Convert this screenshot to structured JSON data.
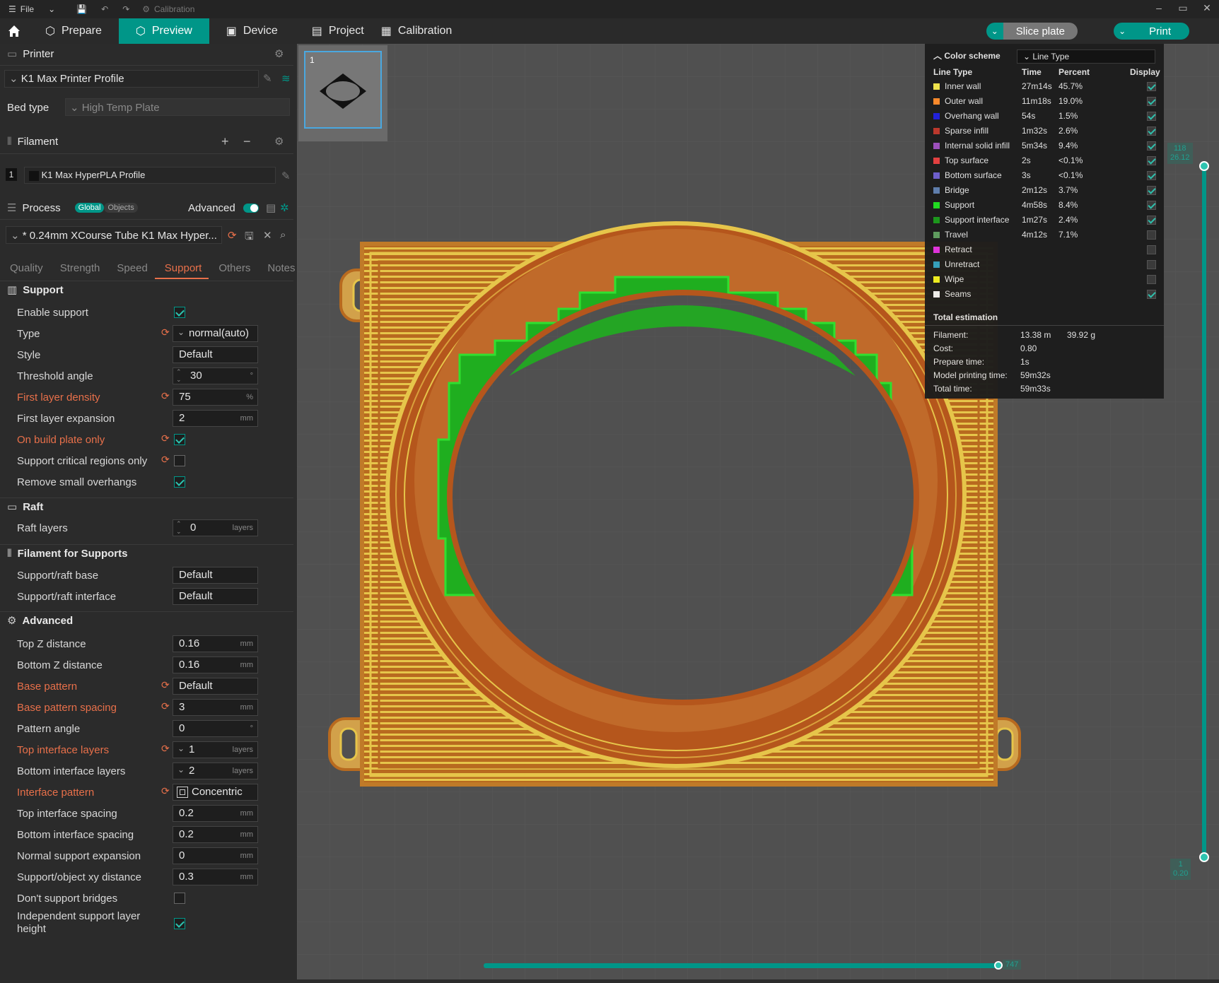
{
  "titlebar": {
    "file_label": "File",
    "calibration_label": "Calibration"
  },
  "nav": {
    "prepare": "Prepare",
    "preview": "Preview",
    "device": "Device",
    "project": "Project",
    "calibration": "Calibration",
    "slice_plate": "Slice plate",
    "print": "Print"
  },
  "printer": {
    "section": "Printer",
    "profile": "K1 Max Printer Profile",
    "bed_type_label": "Bed type",
    "bed_type_value": "High Temp Plate"
  },
  "filament": {
    "section": "Filament",
    "index": "1",
    "profile": "K1 Max HyperPLA Profile"
  },
  "process": {
    "section": "Process",
    "global": "Global",
    "objects": "Objects",
    "advanced": "Advanced",
    "profile": "* 0.24mm XCourse Tube K1 Max Hyper...",
    "tabs": [
      "Quality",
      "Strength",
      "Speed",
      "Support",
      "Others",
      "Notes"
    ]
  },
  "support": {
    "title": "Support",
    "enable_support": "Enable support",
    "type_label": "Type",
    "type_value": "normal(auto)",
    "style_label": "Style",
    "style_value": "Default",
    "threshold_label": "Threshold angle",
    "threshold_value": "30",
    "threshold_unit": "°",
    "first_density_label": "First layer density",
    "first_density_value": "75",
    "first_density_unit": "%",
    "first_expansion_label": "First layer expansion",
    "first_expansion_value": "2",
    "mm": "mm",
    "on_build_plate": "On build plate only",
    "critical_only": "Support critical regions only",
    "remove_small": "Remove small overhangs"
  },
  "raft": {
    "title": "Raft",
    "layers_label": "Raft layers",
    "layers_value": "0",
    "layers_unit": "layers"
  },
  "filament_supports": {
    "title": "Filament for Supports",
    "base_label": "Support/raft base",
    "base_value": "Default",
    "interface_label": "Support/raft interface",
    "interface_value": "Default"
  },
  "advanced": {
    "title": "Advanced",
    "top_z_label": "Top Z distance",
    "top_z_value": "0.16",
    "bottom_z_label": "Bottom Z distance",
    "bottom_z_value": "0.16",
    "base_pattern_label": "Base pattern",
    "base_pattern_value": "Default",
    "base_spacing_label": "Base pattern spacing",
    "base_spacing_value": "3",
    "pattern_angle_label": "Pattern angle",
    "pattern_angle_value": "0",
    "deg": "°",
    "top_interface_layers_label": "Top interface layers",
    "top_interface_layers_value": "1",
    "bottom_interface_layers_label": "Bottom interface layers",
    "bottom_interface_layers_value": "2",
    "interface_pattern_label": "Interface pattern",
    "interface_pattern_value": "Concentric",
    "top_interface_spacing_label": "Top interface spacing",
    "top_interface_spacing_value": "0.2",
    "bottom_interface_spacing_label": "Bottom interface spacing",
    "bottom_interface_spacing_value": "0.2",
    "normal_expansion_label": "Normal support expansion",
    "normal_expansion_value": "0",
    "xy_distance_label": "Support/object xy distance",
    "xy_distance_value": "0.3",
    "dont_bridges_label": "Don't support bridges",
    "independent_label_1": "Independent support layer",
    "independent_label_2": "height",
    "layers_unit": "layers"
  },
  "plate": {
    "number": "1"
  },
  "legend": {
    "title": "Color scheme",
    "mode": "Line Type",
    "col_type": "Line Type",
    "col_time": "Time",
    "col_percent": "Percent",
    "col_display": "Display",
    "rows": [
      {
        "name": "Inner wall",
        "time": "27m14s",
        "percent": "45.7%",
        "color": "#f5e84c",
        "on": true
      },
      {
        "name": "Outer wall",
        "time": "11m18s",
        "percent": "19.0%",
        "color": "#ff8c2a",
        "on": true
      },
      {
        "name": "Overhang wall",
        "time": "54s",
        "percent": "1.5%",
        "color": "#2020e0",
        "on": true
      },
      {
        "name": "Sparse infill",
        "time": "1m32s",
        "percent": "2.6%",
        "color": "#c0382b",
        "on": true
      },
      {
        "name": "Internal solid infill",
        "time": "5m34s",
        "percent": "9.4%",
        "color": "#a050c0",
        "on": true
      },
      {
        "name": "Top surface",
        "time": "2s",
        "percent": "<0.1%",
        "color": "#e84040",
        "on": true
      },
      {
        "name": "Bottom surface",
        "time": "3s",
        "percent": "<0.1%",
        "color": "#7060d0",
        "on": true
      },
      {
        "name": "Bridge",
        "time": "2m12s",
        "percent": "3.7%",
        "color": "#6080b0",
        "on": true
      },
      {
        "name": "Support",
        "time": "4m58s",
        "percent": "8.4%",
        "color": "#20e020",
        "on": true
      },
      {
        "name": "Support interface",
        "time": "1m27s",
        "percent": "2.4%",
        "color": "#1a9a1a",
        "on": true
      },
      {
        "name": "Travel",
        "time": "4m12s",
        "percent": "7.1%",
        "color": "#60a060",
        "on": false
      },
      {
        "name": "Retract",
        "time": "",
        "percent": "",
        "color": "#e030e0",
        "on": false
      },
      {
        "name": "Unretract",
        "time": "",
        "percent": "",
        "color": "#30a0c0",
        "on": false
      },
      {
        "name": "Wipe",
        "time": "",
        "percent": "",
        "color": "#f0f020",
        "on": false
      },
      {
        "name": "Seams",
        "time": "",
        "percent": "",
        "color": "#f0f0f0",
        "on": true
      }
    ],
    "estimation_title": "Total estimation",
    "filament_label": "Filament:",
    "filament_m": "13.38 m",
    "filament_g": "39.92 g",
    "cost_label": "Cost:",
    "cost_value": "0.80",
    "prepare_label": "Prepare time:",
    "prepare_value": "1s",
    "model_label": "Model printing time:",
    "model_value": "59m32s",
    "total_label": "Total time:",
    "total_value": "59m33s"
  },
  "sliders": {
    "top_layer": "118",
    "top_height": "26.12",
    "bottom_layer": "1",
    "bottom_height": "0.20",
    "move": "747"
  }
}
